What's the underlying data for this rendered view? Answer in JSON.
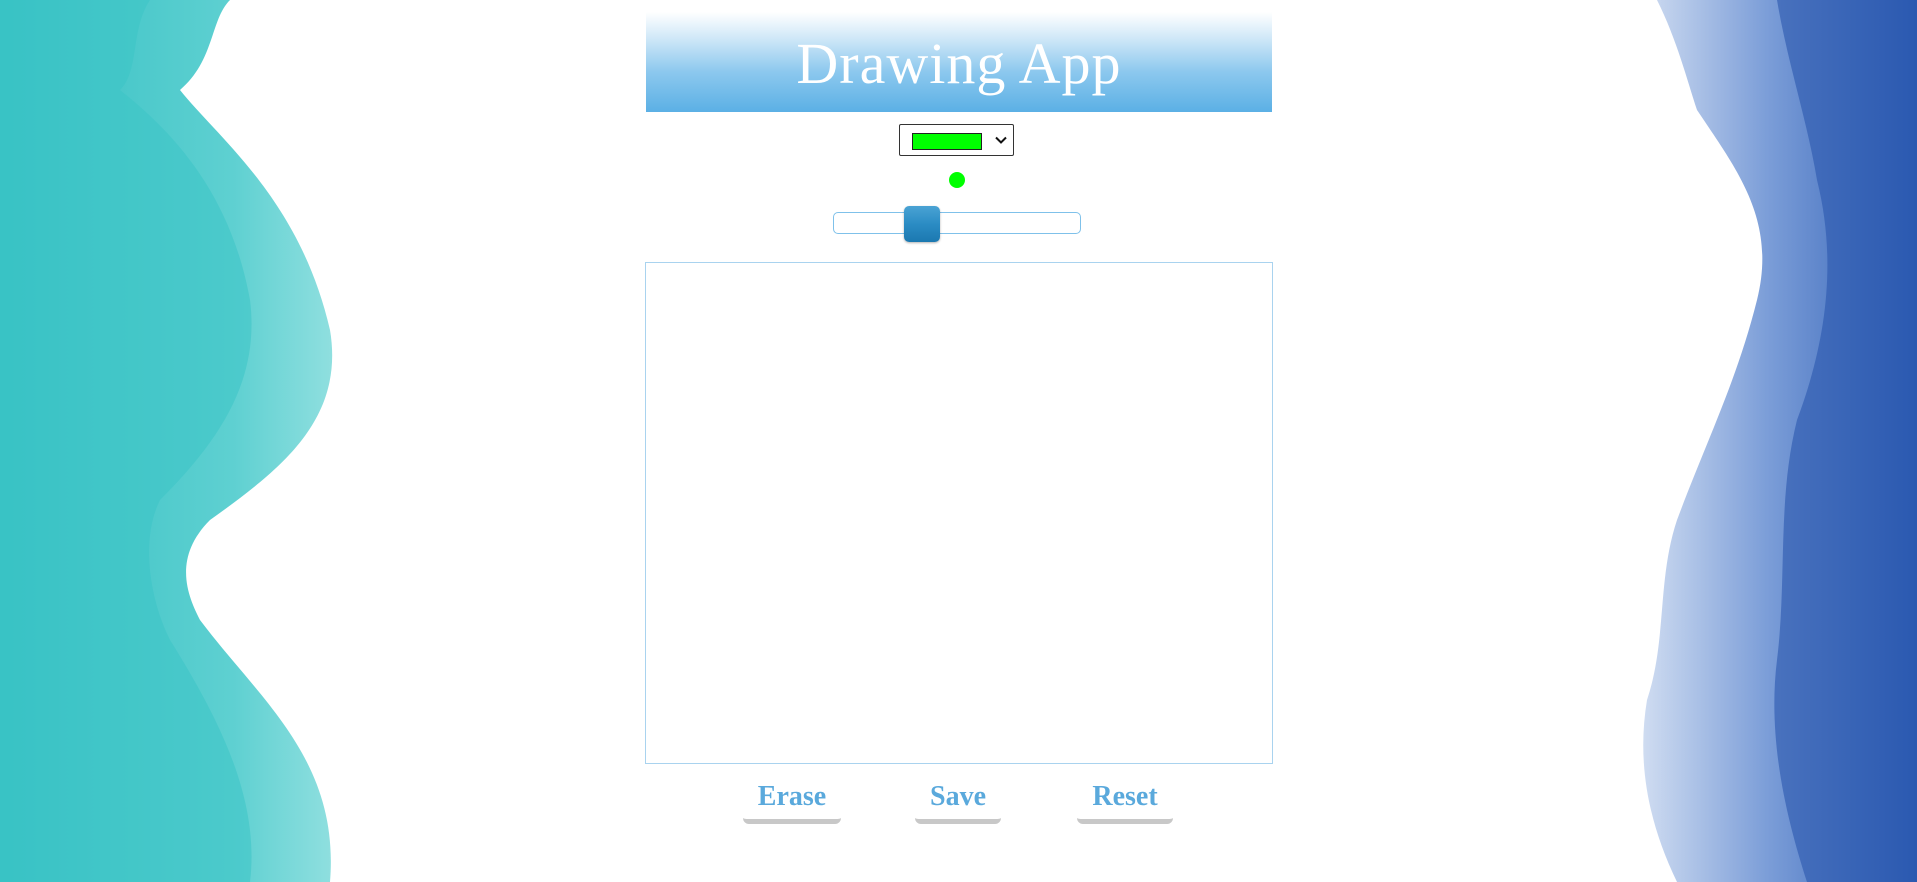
{
  "app": {
    "title": "Drawing App"
  },
  "color_select": {
    "selected_color": "#00ff00",
    "icon": "chevron-down-icon"
  },
  "brush": {
    "preview_color": "#00ff00",
    "size_slider_fraction": 0.33
  },
  "buttons": {
    "erase_label": "Erase",
    "save_label": "Save",
    "reset_label": "Reset"
  },
  "colors": {
    "accent": "#5aa9dc",
    "header_gradient_end": "#5bb0e5",
    "slider_handle": "#2b8cc4",
    "splash_left": "#3fc6c8",
    "splash_right": "#2e5fb8"
  }
}
